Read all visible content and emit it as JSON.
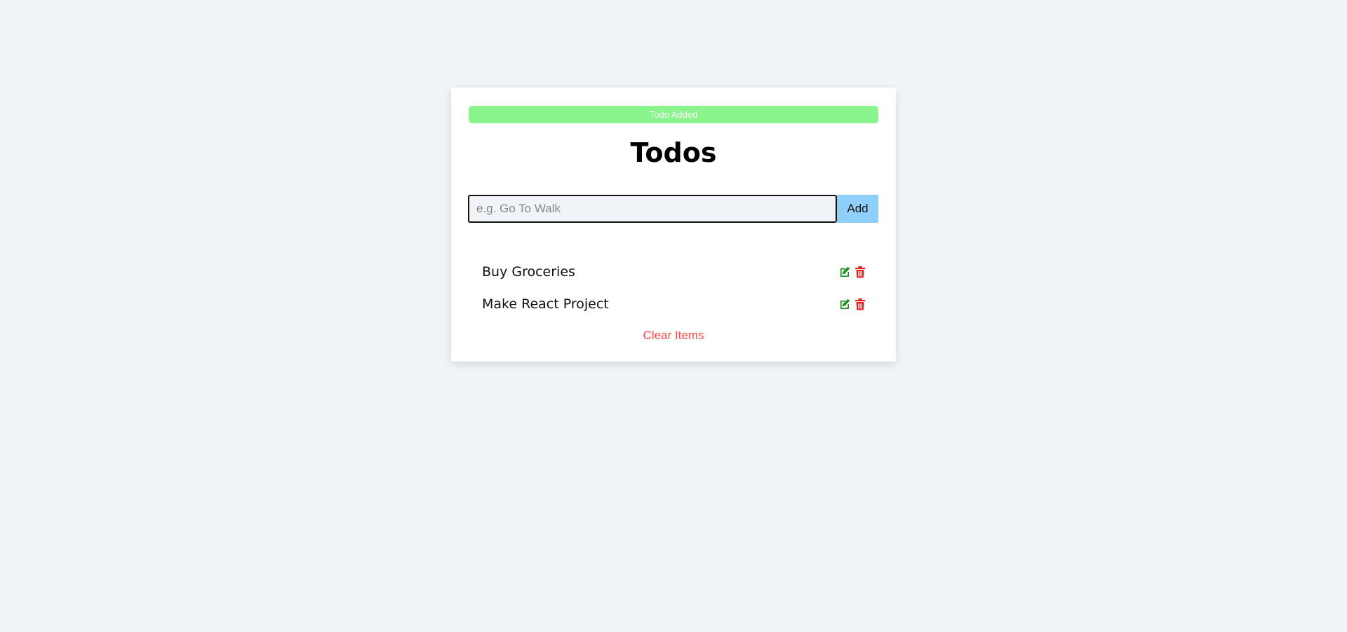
{
  "alert": {
    "text": "Todo Added",
    "color": "#88f48b"
  },
  "title": "Todos",
  "form": {
    "placeholder": "e.g. Go To Walk",
    "value": "",
    "submit_label": "Add"
  },
  "todos": [
    {
      "text": "Buy Groceries",
      "edit_icon": "edit-icon",
      "delete_icon": "trash-icon"
    },
    {
      "text": "Make React Project",
      "edit_icon": "edit-icon",
      "delete_icon": "trash-icon"
    }
  ],
  "clear_label": "Clear Items",
  "colors": {
    "edit": "#1e8f1e",
    "delete": "#e81c1c",
    "clear": "#f14b4b",
    "add_button": "#8fd0fa",
    "background": "#f0f4f7"
  }
}
